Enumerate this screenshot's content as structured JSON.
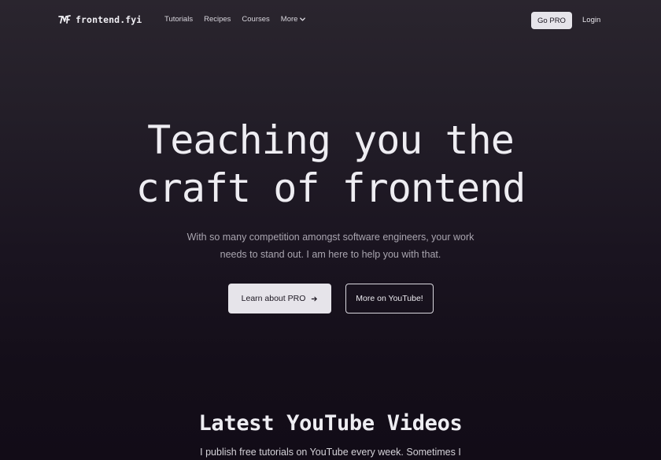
{
  "header": {
    "logo_text": "frontend.fyi",
    "nav": [
      {
        "label": "Tutorials"
      },
      {
        "label": "Recipes"
      },
      {
        "label": "Courses"
      },
      {
        "label": "More"
      }
    ],
    "go_pro_label": "Go PRO",
    "login_label": "Login"
  },
  "hero": {
    "title_line1": "Teaching you the",
    "title_line2": "craft of frontend",
    "subtitle_line1": "With so many competition amongst software engineers, your work",
    "subtitle_line2": "needs to stand out. I am here to help you with that.",
    "learn_button_label": "Learn about PRO",
    "youtube_button_label": "More on YouTube!"
  },
  "videos_section": {
    "title": "Latest YouTube Videos",
    "subtitle": "I publish free tutorials on YouTube every week. Sometimes I"
  },
  "colors": {
    "background_top": "#2a252e",
    "background_bottom": "#120c17",
    "button_light": "#e6e4ea",
    "text_primary": "#eeedf2",
    "text_muted": "#a9a5af"
  }
}
